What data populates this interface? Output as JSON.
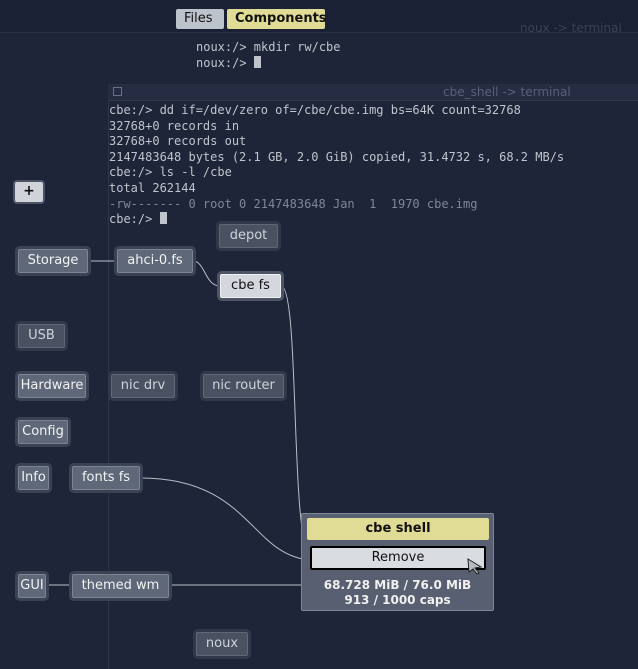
{
  "topbar": {
    "tabs": [
      {
        "label": "Files"
      },
      {
        "label": "Components"
      }
    ],
    "background_window_title": "noux -> terminal"
  },
  "noux_terminal": {
    "lines": [
      "noux:/> mkdir rw/cbe",
      "noux:/> "
    ]
  },
  "cbe_terminal": {
    "title": "cbe_shell -> terminal",
    "lines": [
      "cbe:/> dd if=/dev/zero of=/cbe/cbe.img bs=64K count=32768",
      "32768+0 records in",
      "32768+0 records out",
      "2147483648 bytes (2.1 GB, 2.0 GiB) copied, 31.4732 s, 68.2 MB/s",
      "cbe:/> ls -l /cbe",
      "total 262144",
      "-rw------- 0 root 0 2147483648 Jan  1  1970 cbe.img",
      "cbe:/> "
    ]
  },
  "graph": {
    "add_label": "+",
    "nodes": {
      "storage": "Storage",
      "ahci": "ahci-0.fs",
      "depot": "depot",
      "cbe_fs": "cbe fs",
      "usb": "USB",
      "hardware": "Hardware",
      "nic_drv": "nic drv",
      "nic_router": "nic router",
      "config": "Config",
      "info": "Info",
      "fonts_fs": "fonts fs",
      "gui": "GUI",
      "themed_wm": "themed wm",
      "noux": "noux"
    }
  },
  "context_menu": {
    "title": "cbe shell",
    "remove_label": "Remove",
    "ram": "68.728 MiB / 76.0 MiB",
    "caps": "913 / 1000 caps"
  },
  "colors": {
    "background": "#1e2538",
    "accent": "#e0dc96",
    "node": "#5f6878"
  }
}
